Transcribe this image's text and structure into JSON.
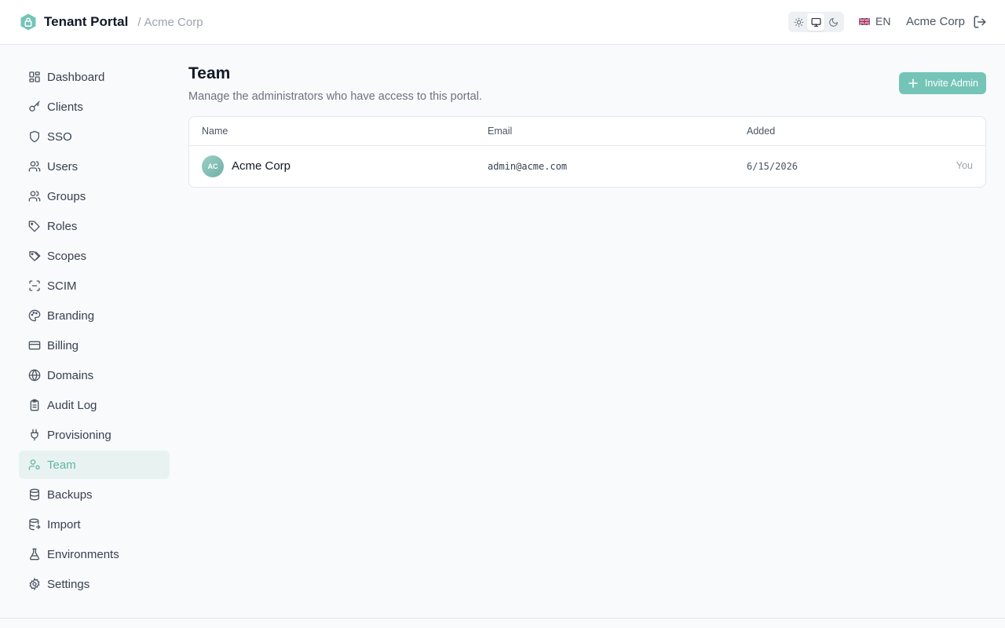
{
  "header": {
    "app_title": "Tenant Portal",
    "breadcrumb_sep": "/",
    "tenant_name": "Acme Corp",
    "language": "EN",
    "account_name": "Acme Corp",
    "theme_options": [
      "sun-icon",
      "monitor-icon",
      "moon-icon"
    ],
    "active_theme": "monitor-icon"
  },
  "sidebar": {
    "items": [
      {
        "label": "Dashboard",
        "icon": "dashboard-icon"
      },
      {
        "label": "Clients",
        "icon": "key-icon"
      },
      {
        "label": "SSO",
        "icon": "shield-icon"
      },
      {
        "label": "Users",
        "icon": "users-icon"
      },
      {
        "label": "Groups",
        "icon": "users-icon"
      },
      {
        "label": "Roles",
        "icon": "tag-icon"
      },
      {
        "label": "Scopes",
        "icon": "tags-icon"
      },
      {
        "label": "SCIM",
        "icon": "scan-icon"
      },
      {
        "label": "Branding",
        "icon": "palette-icon"
      },
      {
        "label": "Billing",
        "icon": "credit-card-icon"
      },
      {
        "label": "Domains",
        "icon": "globe-icon"
      },
      {
        "label": "Audit Log",
        "icon": "clipboard-icon"
      },
      {
        "label": "Provisioning",
        "icon": "plug-icon"
      },
      {
        "label": "Team",
        "icon": "user-cog-icon",
        "active": true
      },
      {
        "label": "Backups",
        "icon": "database-icon"
      },
      {
        "label": "Import",
        "icon": "database-import-icon"
      },
      {
        "label": "Environments",
        "icon": "flask-icon"
      },
      {
        "label": "Settings",
        "icon": "gear-icon"
      }
    ]
  },
  "main": {
    "title": "Team",
    "subtitle": "Manage the administrators who have access to this portal.",
    "invite_label": "Invite Admin",
    "table": {
      "columns": [
        "Name",
        "Email",
        "Added"
      ],
      "rows": [
        {
          "initials": "AC",
          "name": "Acme Corp",
          "email": "admin@acme.com",
          "added": "6/15/2026",
          "tag": "You"
        }
      ]
    }
  },
  "colors": {
    "accent": "#5fb5a8",
    "accent_button": "#74c4b7",
    "active_bg": "#e8f3f1"
  }
}
